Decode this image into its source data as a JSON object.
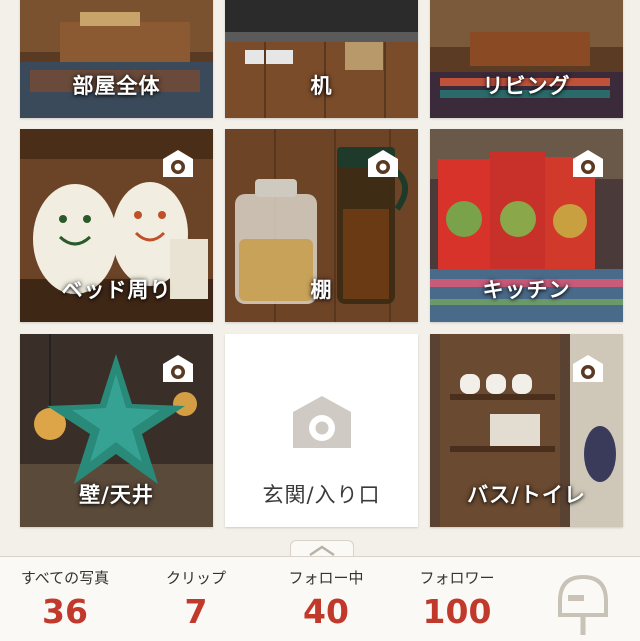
{
  "tiles": [
    {
      "label": "部屋全体",
      "camera_icon": false
    },
    {
      "label": "机",
      "camera_icon": false
    },
    {
      "label": "リビング",
      "camera_icon": false
    },
    {
      "label": "ベッド周り",
      "camera_icon": true
    },
    {
      "label": "棚",
      "camera_icon": true
    },
    {
      "label": "キッチン",
      "camera_icon": true
    },
    {
      "label": "壁/天井",
      "camera_icon": true
    },
    {
      "label": "玄関/入り口",
      "camera_icon": "placeholder"
    },
    {
      "label": "バス/トイレ",
      "camera_icon": true
    }
  ],
  "stats": [
    {
      "label": "すべての写真",
      "value": "36"
    },
    {
      "label": "クリップ",
      "value": "7"
    },
    {
      "label": "フォロー中",
      "value": "40"
    },
    {
      "label": "フォロワー",
      "value": "100"
    }
  ],
  "icons": {
    "pull_tab": "chevron-up-icon",
    "mailbox": "mailbox-icon",
    "tile_camera": "camera-icon"
  },
  "colors": {
    "count_accent": "#c0392b",
    "background": "#f3efe9",
    "bar_background": "#fbf9f6"
  }
}
